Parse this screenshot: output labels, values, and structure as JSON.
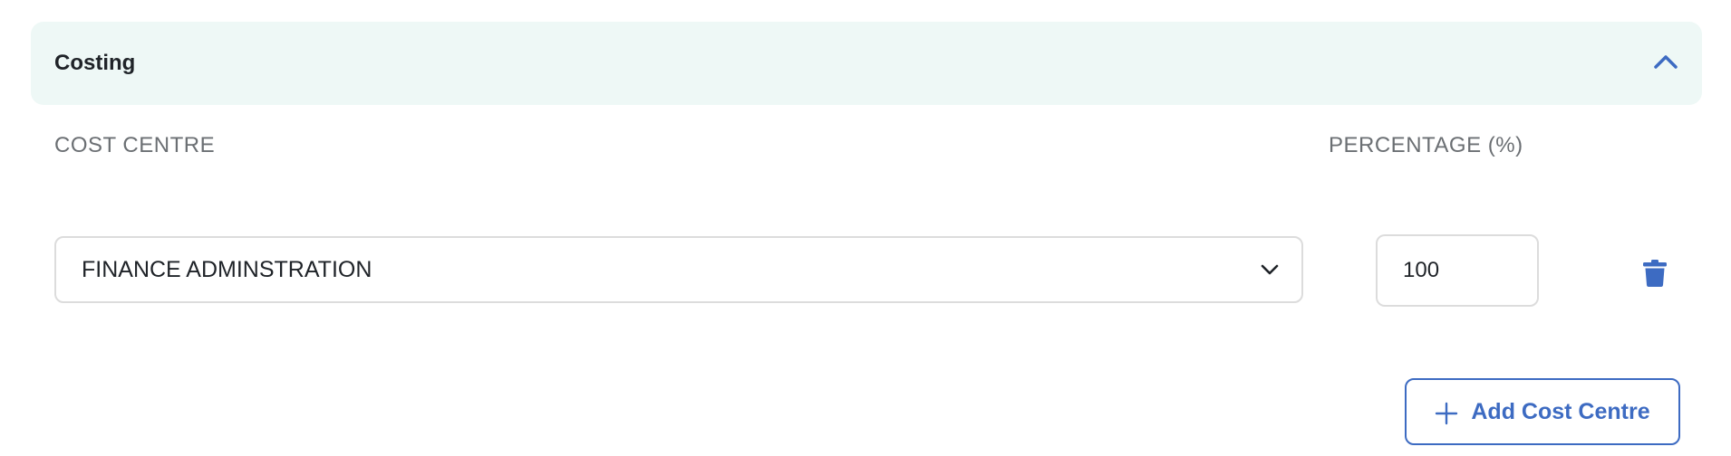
{
  "section": {
    "title": "Costing",
    "expanded": true
  },
  "columns": {
    "cost_centre_label": "COST CENTRE",
    "percentage_label": "PERCENTAGE (%)"
  },
  "rows": [
    {
      "cost_centre": "FINANCE ADMINSTRATION",
      "percentage": "100"
    }
  ],
  "actions": {
    "add_label": "Add Cost Centre"
  },
  "icons": {
    "collapse": "chevron-up-icon",
    "select": "chevron-down-icon",
    "delete": "trash-icon",
    "add": "plus-icon"
  },
  "colors": {
    "accent": "#3d6bc2",
    "header_bg": "#eef8f6",
    "label_grey": "#6b6f73",
    "border": "#dcdcdc"
  }
}
